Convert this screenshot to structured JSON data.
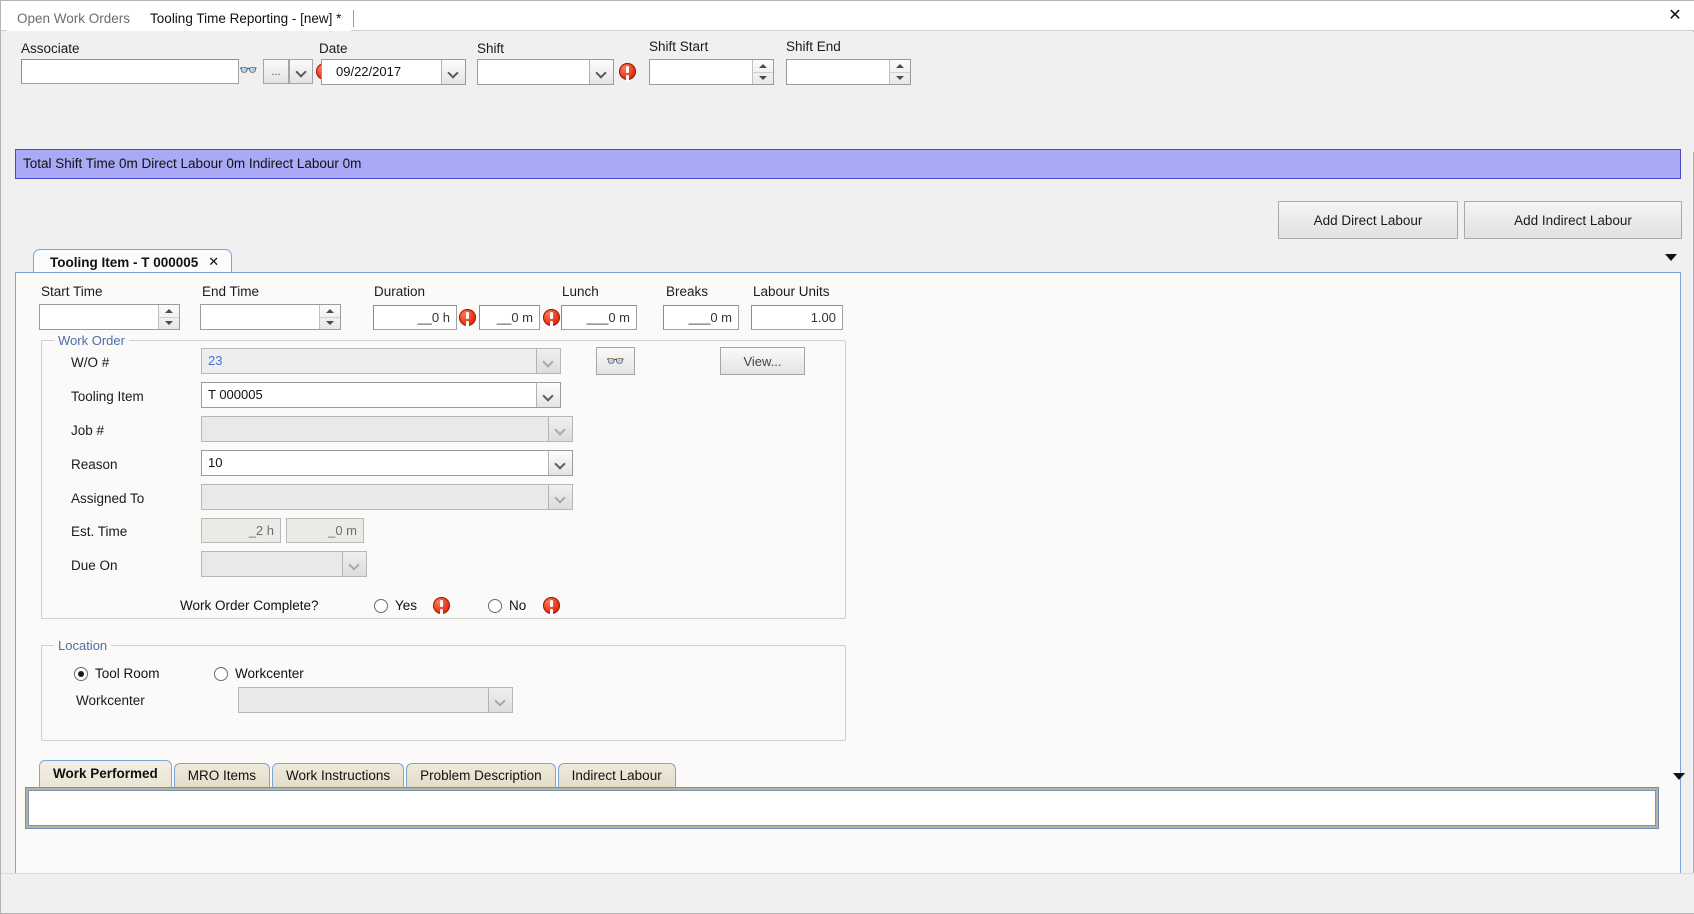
{
  "window": {
    "close_label": "✕"
  },
  "doc_tabs": [
    {
      "label": "Open Work Orders",
      "active": false
    },
    {
      "label": "Tooling Time Reporting - [new] *",
      "active": true
    }
  ],
  "header": {
    "associate": {
      "label": "Associate",
      "value": "",
      "find_icon": "binoculars-icon",
      "ellipsis_label": "...",
      "dropdown_icon": "chevron-down-icon"
    },
    "date": {
      "label": "Date",
      "value": "09/22/2017",
      "error": true
    },
    "shift": {
      "label": "Shift",
      "value": "",
      "error": true
    },
    "shift_start": {
      "label": "Shift Start",
      "value": ""
    },
    "shift_end": {
      "label": "Shift End",
      "value": ""
    }
  },
  "banner": {
    "text": "Total Shift Time 0m  Direct Labour 0m  Indirect Labour 0m"
  },
  "actions": {
    "add_direct": "Add Direct Labour",
    "add_indirect": "Add Indirect Labour"
  },
  "item_tab": {
    "title": "Tooling Item - T 000005",
    "close_label": "✕",
    "strip_arrow_icon": "chevron-down-icon"
  },
  "time_row": {
    "start_time": {
      "label": "Start Time",
      "value": ""
    },
    "end_time": {
      "label": "End Time",
      "value": ""
    },
    "duration": {
      "label": "Duration",
      "hours": "__0 h",
      "minutes": "__0 m",
      "hours_error": true,
      "minutes_error": true
    },
    "lunch": {
      "label": "Lunch",
      "value": "___0 m"
    },
    "breaks": {
      "label": "Breaks",
      "value": "___0 m"
    },
    "labour_units": {
      "label": "Labour Units",
      "value": "1.00"
    }
  },
  "work_order": {
    "group_label": "Work Order",
    "wo_number": {
      "label": "W/O #",
      "value": "23"
    },
    "tooling_item": {
      "label": "Tooling Item",
      "value": "T 000005"
    },
    "job_number": {
      "label": "Job #",
      "value": ""
    },
    "reason": {
      "label": "Reason",
      "value": "10"
    },
    "assigned_to": {
      "label": "Assigned To",
      "value": ""
    },
    "est_time": {
      "label": "Est. Time",
      "hours": "_2 h",
      "minutes": "_0 m"
    },
    "due_on": {
      "label": "Due On",
      "value": ""
    },
    "find_icon": "binoculars-icon",
    "view_button": "View...",
    "complete": {
      "label": "Work Order Complete?",
      "yes_label": "Yes",
      "no_label": "No",
      "yes_selected": false,
      "no_selected": false,
      "yes_error": true,
      "no_error": true
    }
  },
  "location": {
    "group_label": "Location",
    "tool_room": {
      "label": "Tool Room",
      "selected": true
    },
    "workcenter_radio": {
      "label": "Workcenter",
      "selected": false
    },
    "workcenter_field": {
      "label": "Workcenter",
      "value": ""
    }
  },
  "bottom_tabs": [
    {
      "label": "Work Performed",
      "active": true
    },
    {
      "label": "MRO Items",
      "active": false
    },
    {
      "label": "Work Instructions",
      "active": false
    },
    {
      "label": "Problem Description",
      "active": false
    },
    {
      "label": "Indirect Labour",
      "active": false
    }
  ],
  "notes": {
    "value": ""
  },
  "colors": {
    "banner_bg": "#a9a9f5",
    "banner_border": "#4747c8",
    "panel_border": "#7ca5d8",
    "group_label": "#4c6fa5",
    "error_red": "#e8391a",
    "tab_beige": "#e8e2d0"
  }
}
